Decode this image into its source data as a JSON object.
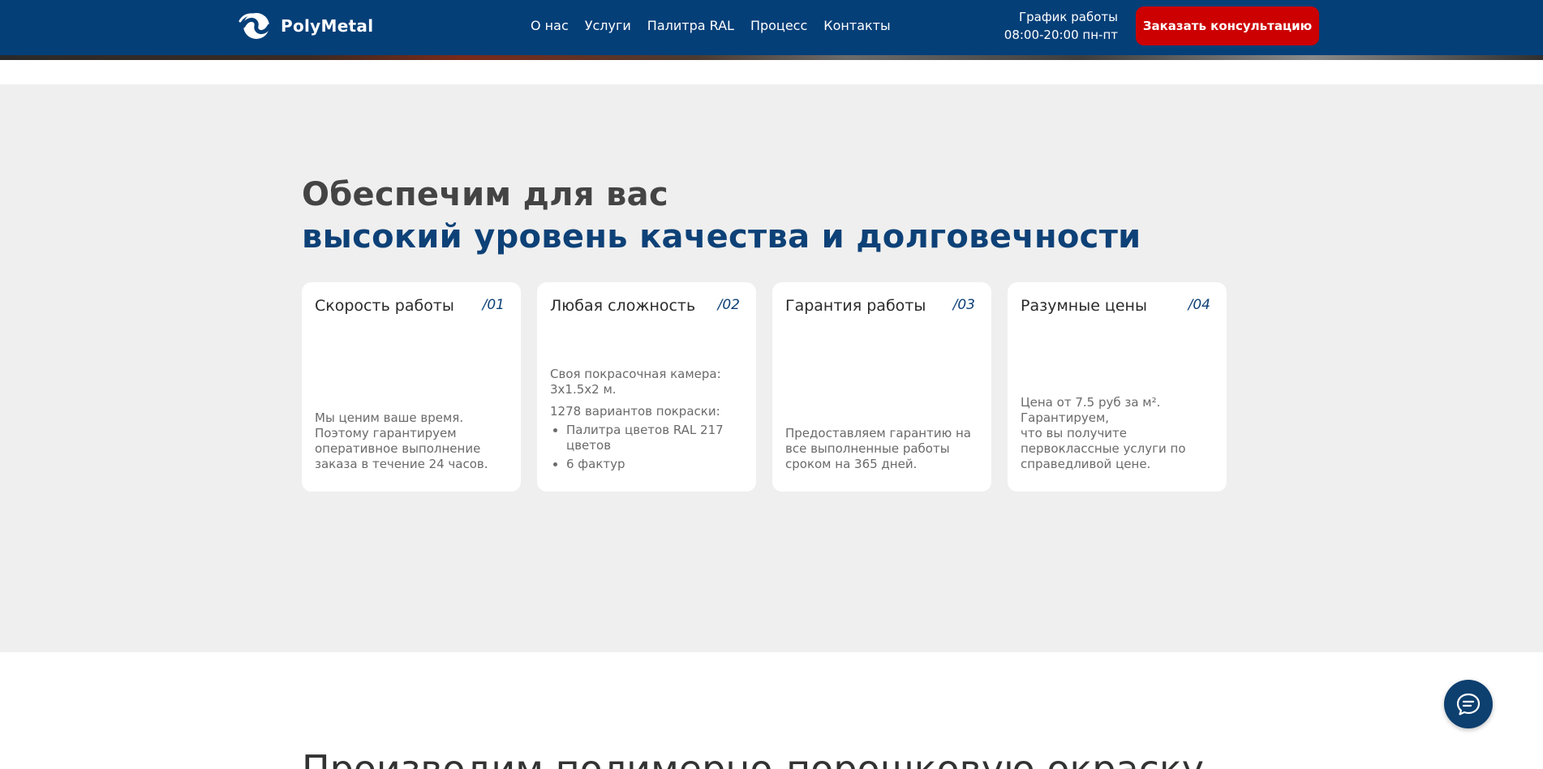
{
  "header": {
    "logo_text": "PolyMetal",
    "nav": [
      "О нас",
      "Услуги",
      "Палитра RAL",
      "Процесс",
      "Контакты"
    ],
    "schedule_label": "График работы",
    "schedule_hours": "08:00-20:00 пн-пт",
    "cta_label": "Заказать консультацию"
  },
  "section": {
    "heading_line1": "Обеспечим для вас",
    "heading_line2": "высокий уровень качества и долговечности",
    "cards": [
      {
        "title": "Скорость работы",
        "num": "/01",
        "text": "Мы ценим ваше время. Поэтому гарантируем оперативное выполнение заказа в течение 24 часов."
      },
      {
        "title": "Любая сложность",
        "num": "/02",
        "text1": "Своя покрасочная камера: 3x1.5x2 м.",
        "text2": "1278 вариантов покраски:",
        "bullets": [
          "Палитра цветов RAL 217 цветов",
          "6 фактур"
        ]
      },
      {
        "title": "Гарантия работы",
        "num": "/03",
        "text": "Предоставляем гарантию на все выполненные работы сроком на 365 дней."
      },
      {
        "title": "Разумные цены",
        "num": "/04",
        "text1": "Цена от 7.5 руб за м².",
        "text2": "Гарантируем,",
        "text3": "что вы получите первоклассные услуги по справедливой цене."
      }
    ]
  },
  "next_heading": "Производим полимерно-порошковую окраску",
  "colors": {
    "header_bg": "#053f78",
    "cta_bg": "#cc0000",
    "accent": "#0d4177",
    "section_bg": "#efefef"
  },
  "icons": [
    "polymetal-logo-icon",
    "chat-icon"
  ]
}
